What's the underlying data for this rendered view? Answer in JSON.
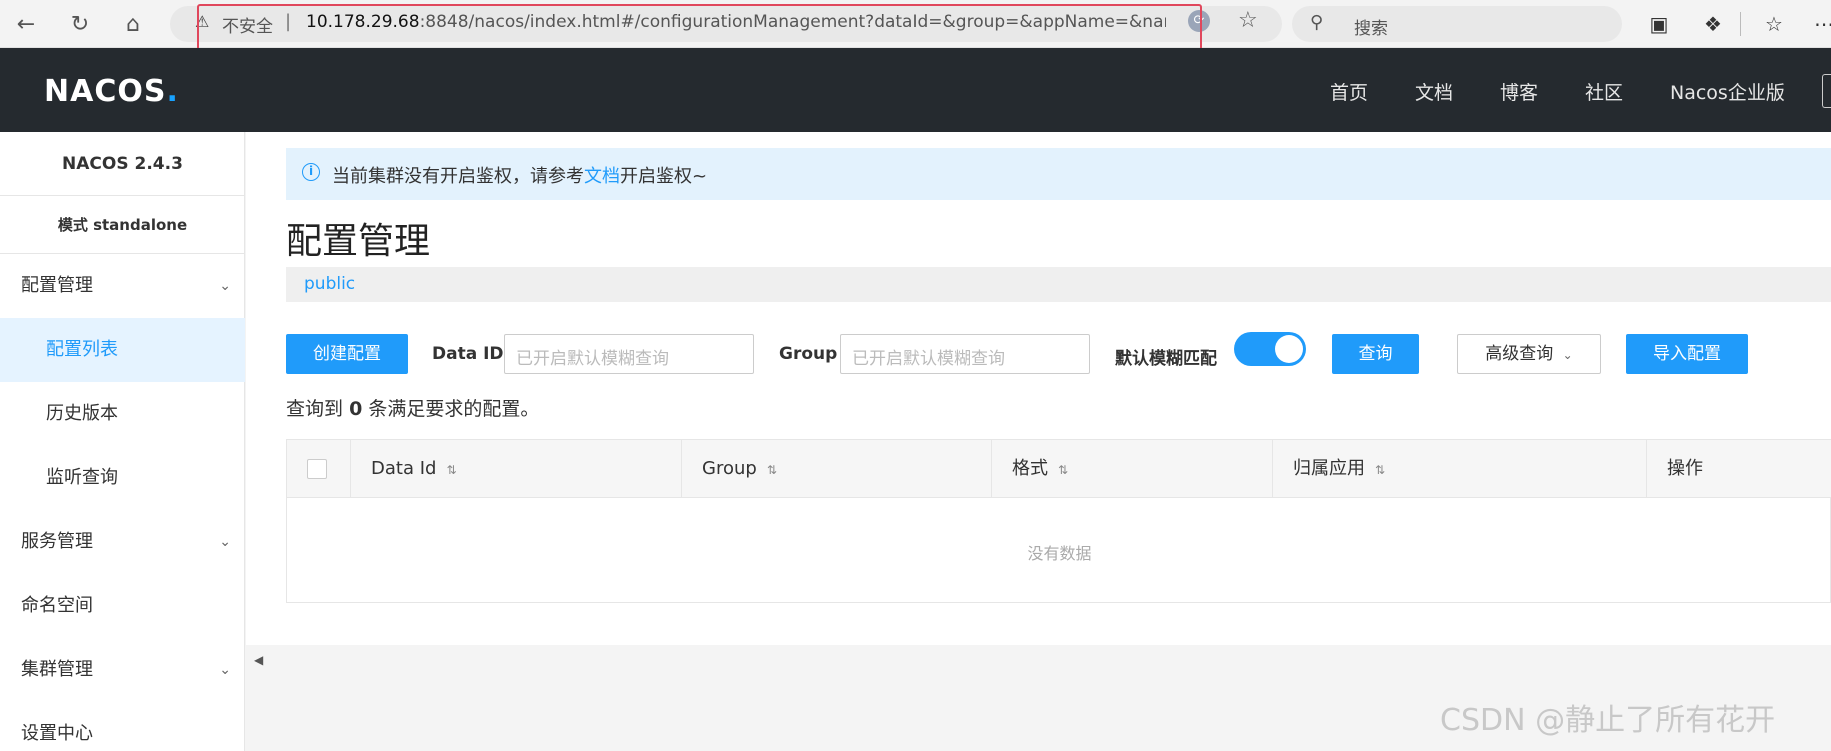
{
  "browser": {
    "insecure_label": "不安全",
    "url_host": "10.178.29.68",
    "url_rest": ":8848/nacos/index.html#/configurationManagement?dataId=&group=&appName=&namespace...",
    "search_placeholder": "搜索"
  },
  "header": {
    "logo": "NACOS",
    "logo_dot": ".",
    "nav": [
      "首页",
      "文档",
      "博客",
      "社区",
      "Nacos企业版"
    ]
  },
  "sidebar": {
    "version": "NACOS 2.4.3",
    "mode": "模式 standalone",
    "items": [
      {
        "label": "配置管理"
      },
      {
        "label": "配置列表"
      },
      {
        "label": "历史版本"
      },
      {
        "label": "监听查询"
      },
      {
        "label": "服务管理"
      },
      {
        "label": "命名空间"
      },
      {
        "label": "集群管理"
      },
      {
        "label": "设置中心"
      }
    ]
  },
  "notice": {
    "before": "当前集群没有开启鉴权，请参考",
    "link": "文档",
    "after": "开启鉴权~"
  },
  "page": {
    "title": "配置管理",
    "namespace": "public"
  },
  "toolbar": {
    "create_label": "创建配置",
    "data_id_label": "Data ID",
    "data_id_placeholder": "已开启默认模糊查询",
    "group_label": "Group",
    "group_placeholder": "已开启默认模糊查询",
    "fuzzy_label": "默认模糊匹配",
    "fuzzy_on": true,
    "query_label": "查询",
    "advanced_label": "高级查询",
    "import_label": "导入配置"
  },
  "result": {
    "prefix": "查询到",
    "count": "0",
    "suffix": "条满足要求的配置。"
  },
  "table": {
    "columns": [
      "Data Id",
      "Group",
      "格式",
      "归属应用",
      "操作"
    ],
    "empty_text": "没有数据"
  },
  "watermark": "CSDN @静止了所有花开",
  "colors": {
    "accent": "#209bfa",
    "header_bg": "#252a2f",
    "highlight_border": "#e0475c"
  }
}
